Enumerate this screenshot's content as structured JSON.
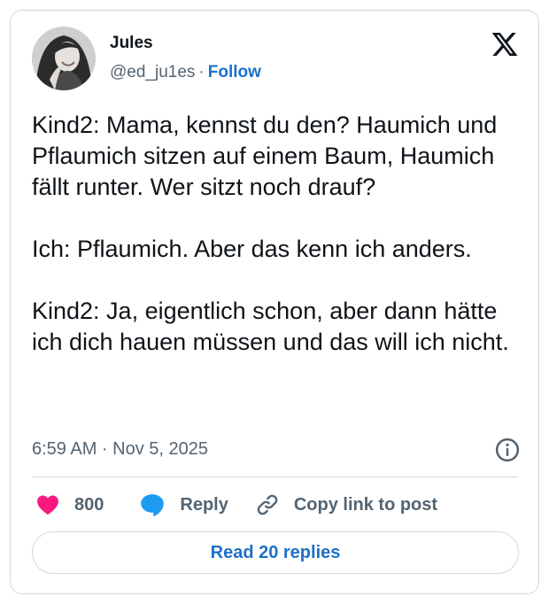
{
  "tweet": {
    "author": {
      "name": "Jules",
      "handle": "@ed_ju1es",
      "follow_label": "Follow"
    },
    "text": "Kind2: Mama, kennst du den? Haumich und Pflaumich sitzen auf einem Baum, Haumich fällt runter. Wer sitzt noch drauf?\n\nIch: Pflaumich. Aber das kenn ich anders.\n\nKind2: Ja, eigentlich schon, aber dann hätte ich dich hauen müssen und das will ich nicht.",
    "timestamp": "6:59 AM · Nov 5, 2025",
    "actions": {
      "likes_count": "800",
      "reply_label": "Reply",
      "copy_link_label": "Copy link to post"
    },
    "read_replies_label": "Read 20 replies"
  },
  "colors": {
    "like_pink": "#f91880",
    "reply_blue": "#1d9bf0",
    "link_blue": "#1d70c9",
    "secondary_text": "#536471",
    "border": "#cfd9de"
  },
  "icons": {
    "brand": "x-logo-icon",
    "info": "info-icon",
    "like": "heart-icon",
    "reply": "speech-bubble-icon",
    "copy": "link-icon"
  }
}
